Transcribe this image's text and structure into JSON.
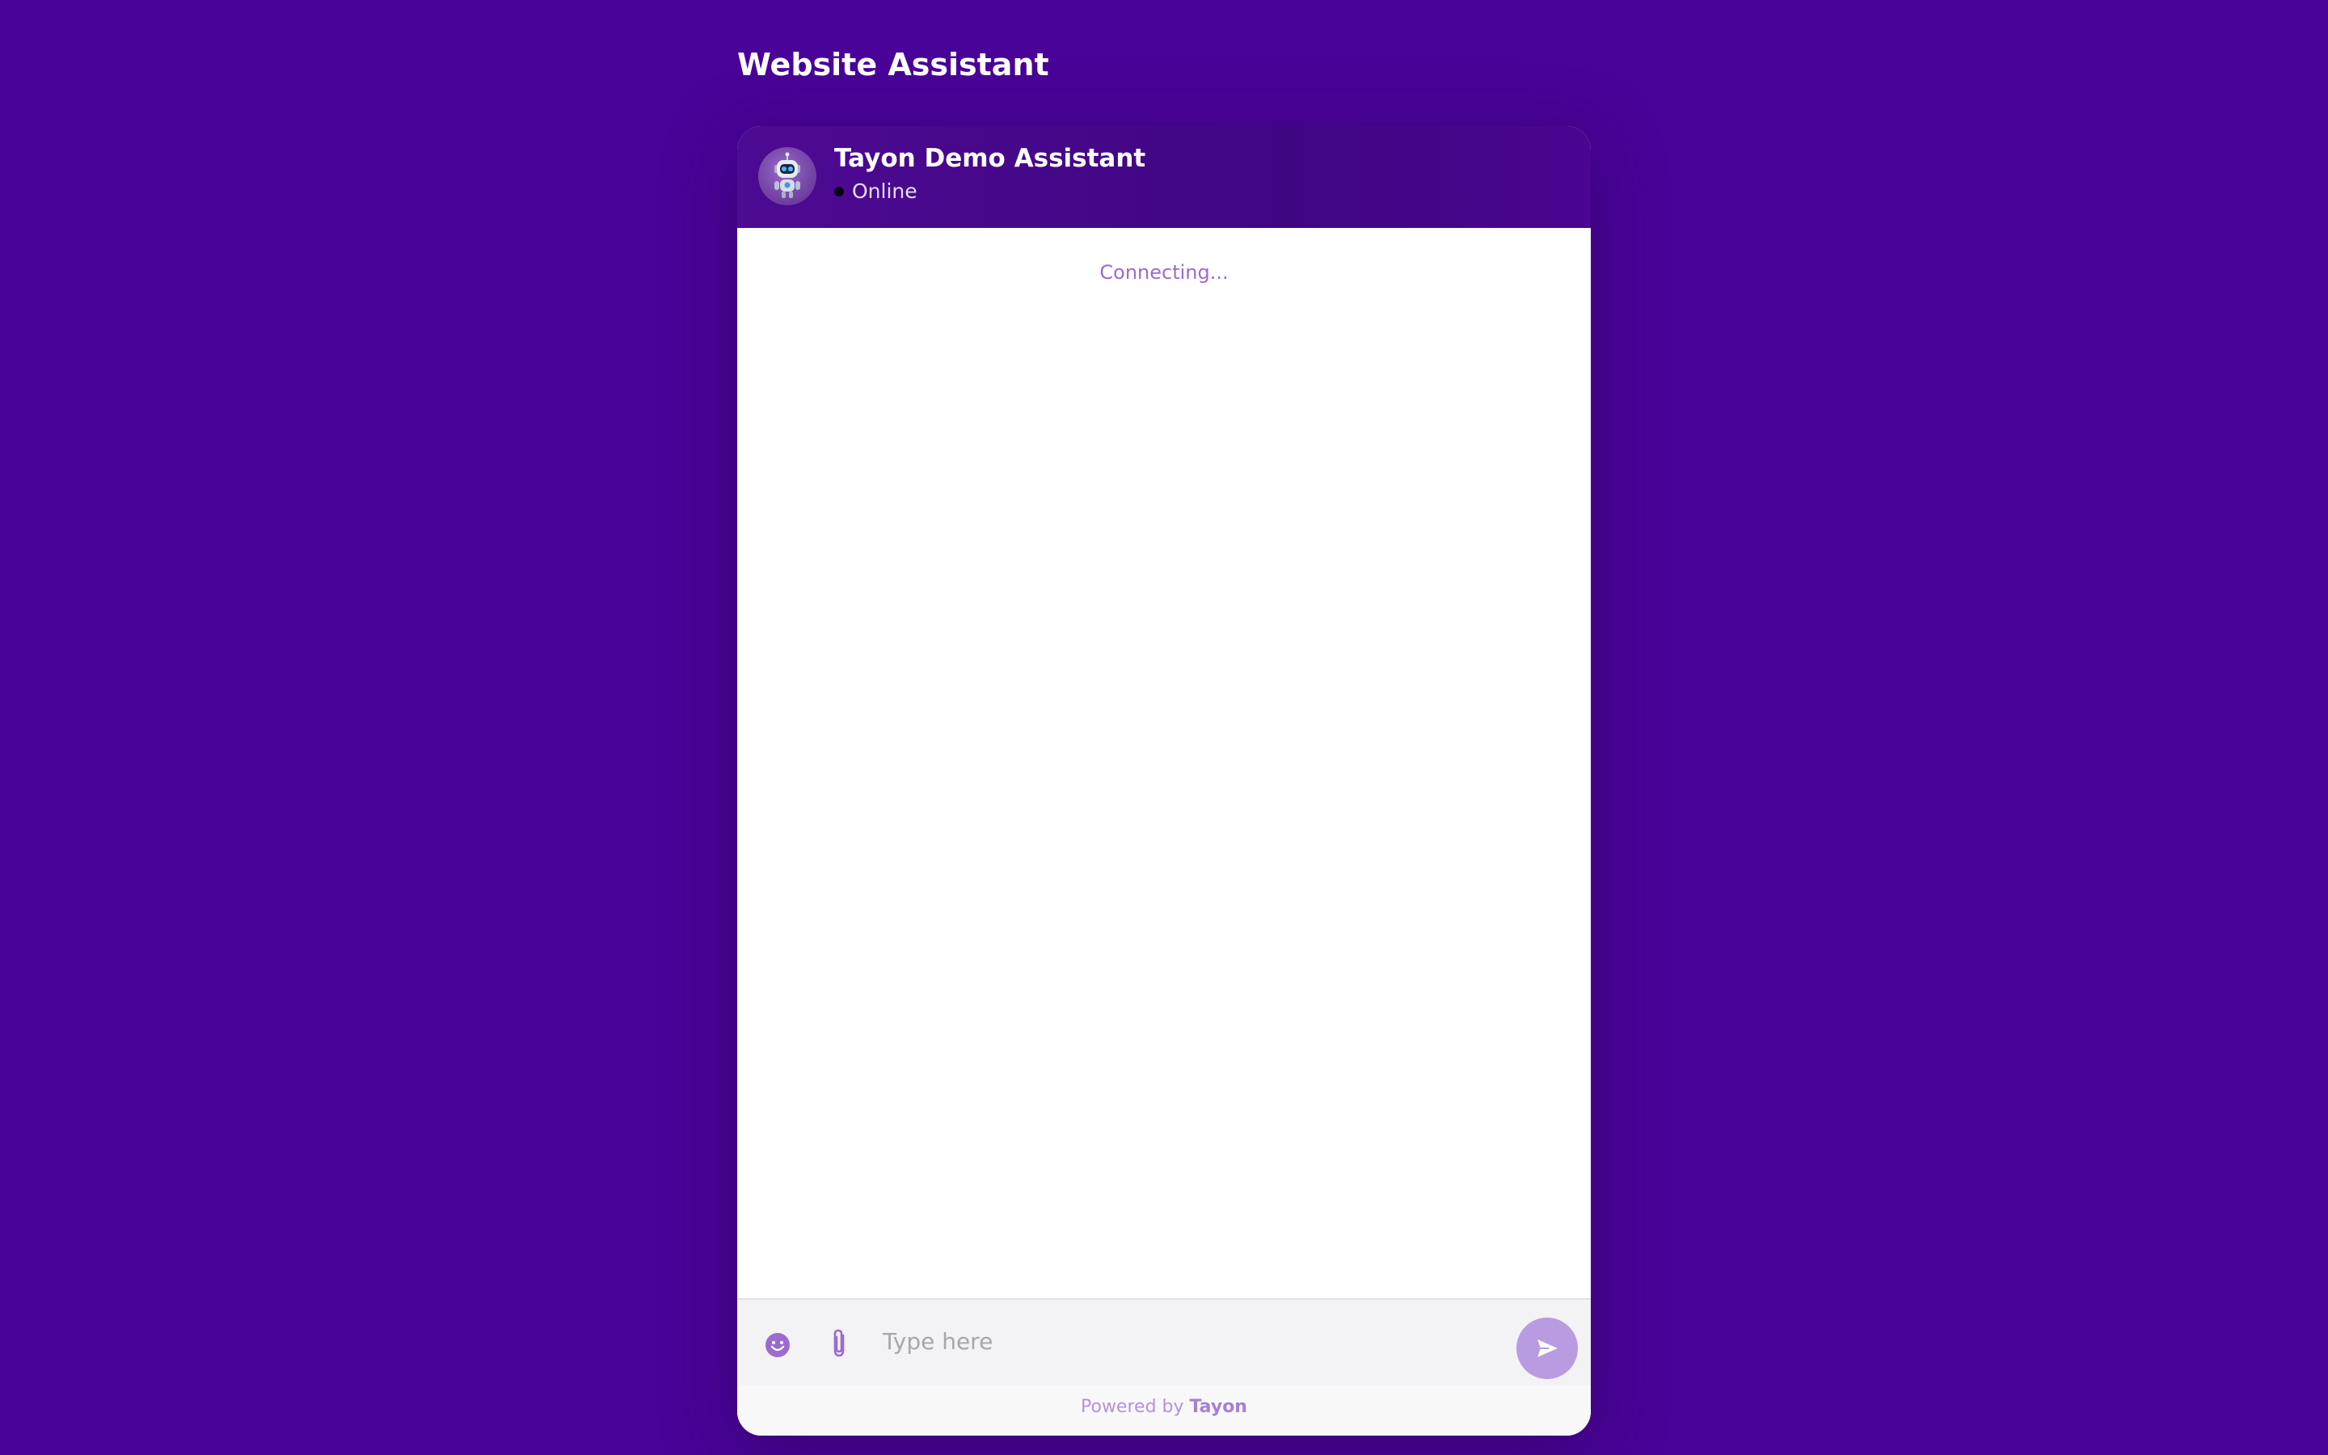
{
  "page": {
    "title": "Website Assistant"
  },
  "chat": {
    "header": {
      "assistant_name": "Tayon Demo Assistant",
      "status": "Online",
      "avatar_icon": "robot-avatar-icon"
    },
    "messages": {
      "status_text": "Connecting..."
    },
    "composer": {
      "placeholder": "Type here",
      "value": "",
      "emoji_icon": "emoji-icon",
      "attach_icon": "paperclip-icon",
      "send_icon": "send-icon"
    },
    "footer": {
      "powered_by": "Powered by",
      "brand": "Tayon"
    }
  },
  "colors": {
    "page_background": "#4a0398",
    "header_background": "#3f0682",
    "accent": "#9b6bd0",
    "send_button": "#b89be0",
    "status_dot": "#0a0612"
  }
}
